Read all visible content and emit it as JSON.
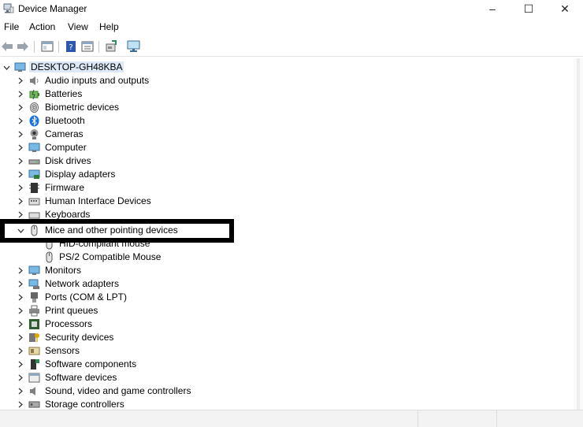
{
  "window": {
    "title": "Device Manager",
    "controls": {
      "minimize": "–",
      "maximize": "☐",
      "close": "✕"
    }
  },
  "menu": [
    "File",
    "Action",
    "View",
    "Help"
  ],
  "tree": {
    "root": "DESKTOP-GH48KBA",
    "categories": [
      {
        "label": "Audio inputs and outputs",
        "icon": "speaker-icon"
      },
      {
        "label": "Batteries",
        "icon": "battery-icon"
      },
      {
        "label": "Biometric devices",
        "icon": "fingerprint-icon"
      },
      {
        "label": "Bluetooth",
        "icon": "bluetooth-icon"
      },
      {
        "label": "Cameras",
        "icon": "camera-icon"
      },
      {
        "label": "Computer",
        "icon": "monitor-icon"
      },
      {
        "label": "Disk drives",
        "icon": "disk-drive-icon"
      },
      {
        "label": "Display adapters",
        "icon": "display-adapter-icon"
      },
      {
        "label": "Firmware",
        "icon": "firmware-icon"
      },
      {
        "label": "Human Interface Devices",
        "icon": "hid-icon"
      },
      {
        "label": "Keyboards",
        "icon": "keyboard-icon"
      },
      {
        "label": "Mice and other pointing devices",
        "icon": "mouse-icon",
        "expanded": true,
        "children": [
          {
            "label": "HID-compliant mouse"
          },
          {
            "label": "PS/2 Compatible Mouse"
          }
        ]
      },
      {
        "label": "Monitors",
        "icon": "monitor-icon"
      },
      {
        "label": "Network adapters",
        "icon": "network-icon"
      },
      {
        "label": "Ports (COM & LPT)",
        "icon": "port-icon"
      },
      {
        "label": "Print queues",
        "icon": "printer-icon"
      },
      {
        "label": "Processors",
        "icon": "processor-icon"
      },
      {
        "label": "Security devices",
        "icon": "security-key-icon"
      },
      {
        "label": "Sensors",
        "icon": "sensor-icon"
      },
      {
        "label": "Software components",
        "icon": "software-component-icon"
      },
      {
        "label": "Software devices",
        "icon": "software-device-icon"
      },
      {
        "label": "Sound, video and game controllers",
        "icon": "sound-icon"
      },
      {
        "label": "Storage controllers",
        "icon": "storage-controller-icon"
      }
    ]
  }
}
